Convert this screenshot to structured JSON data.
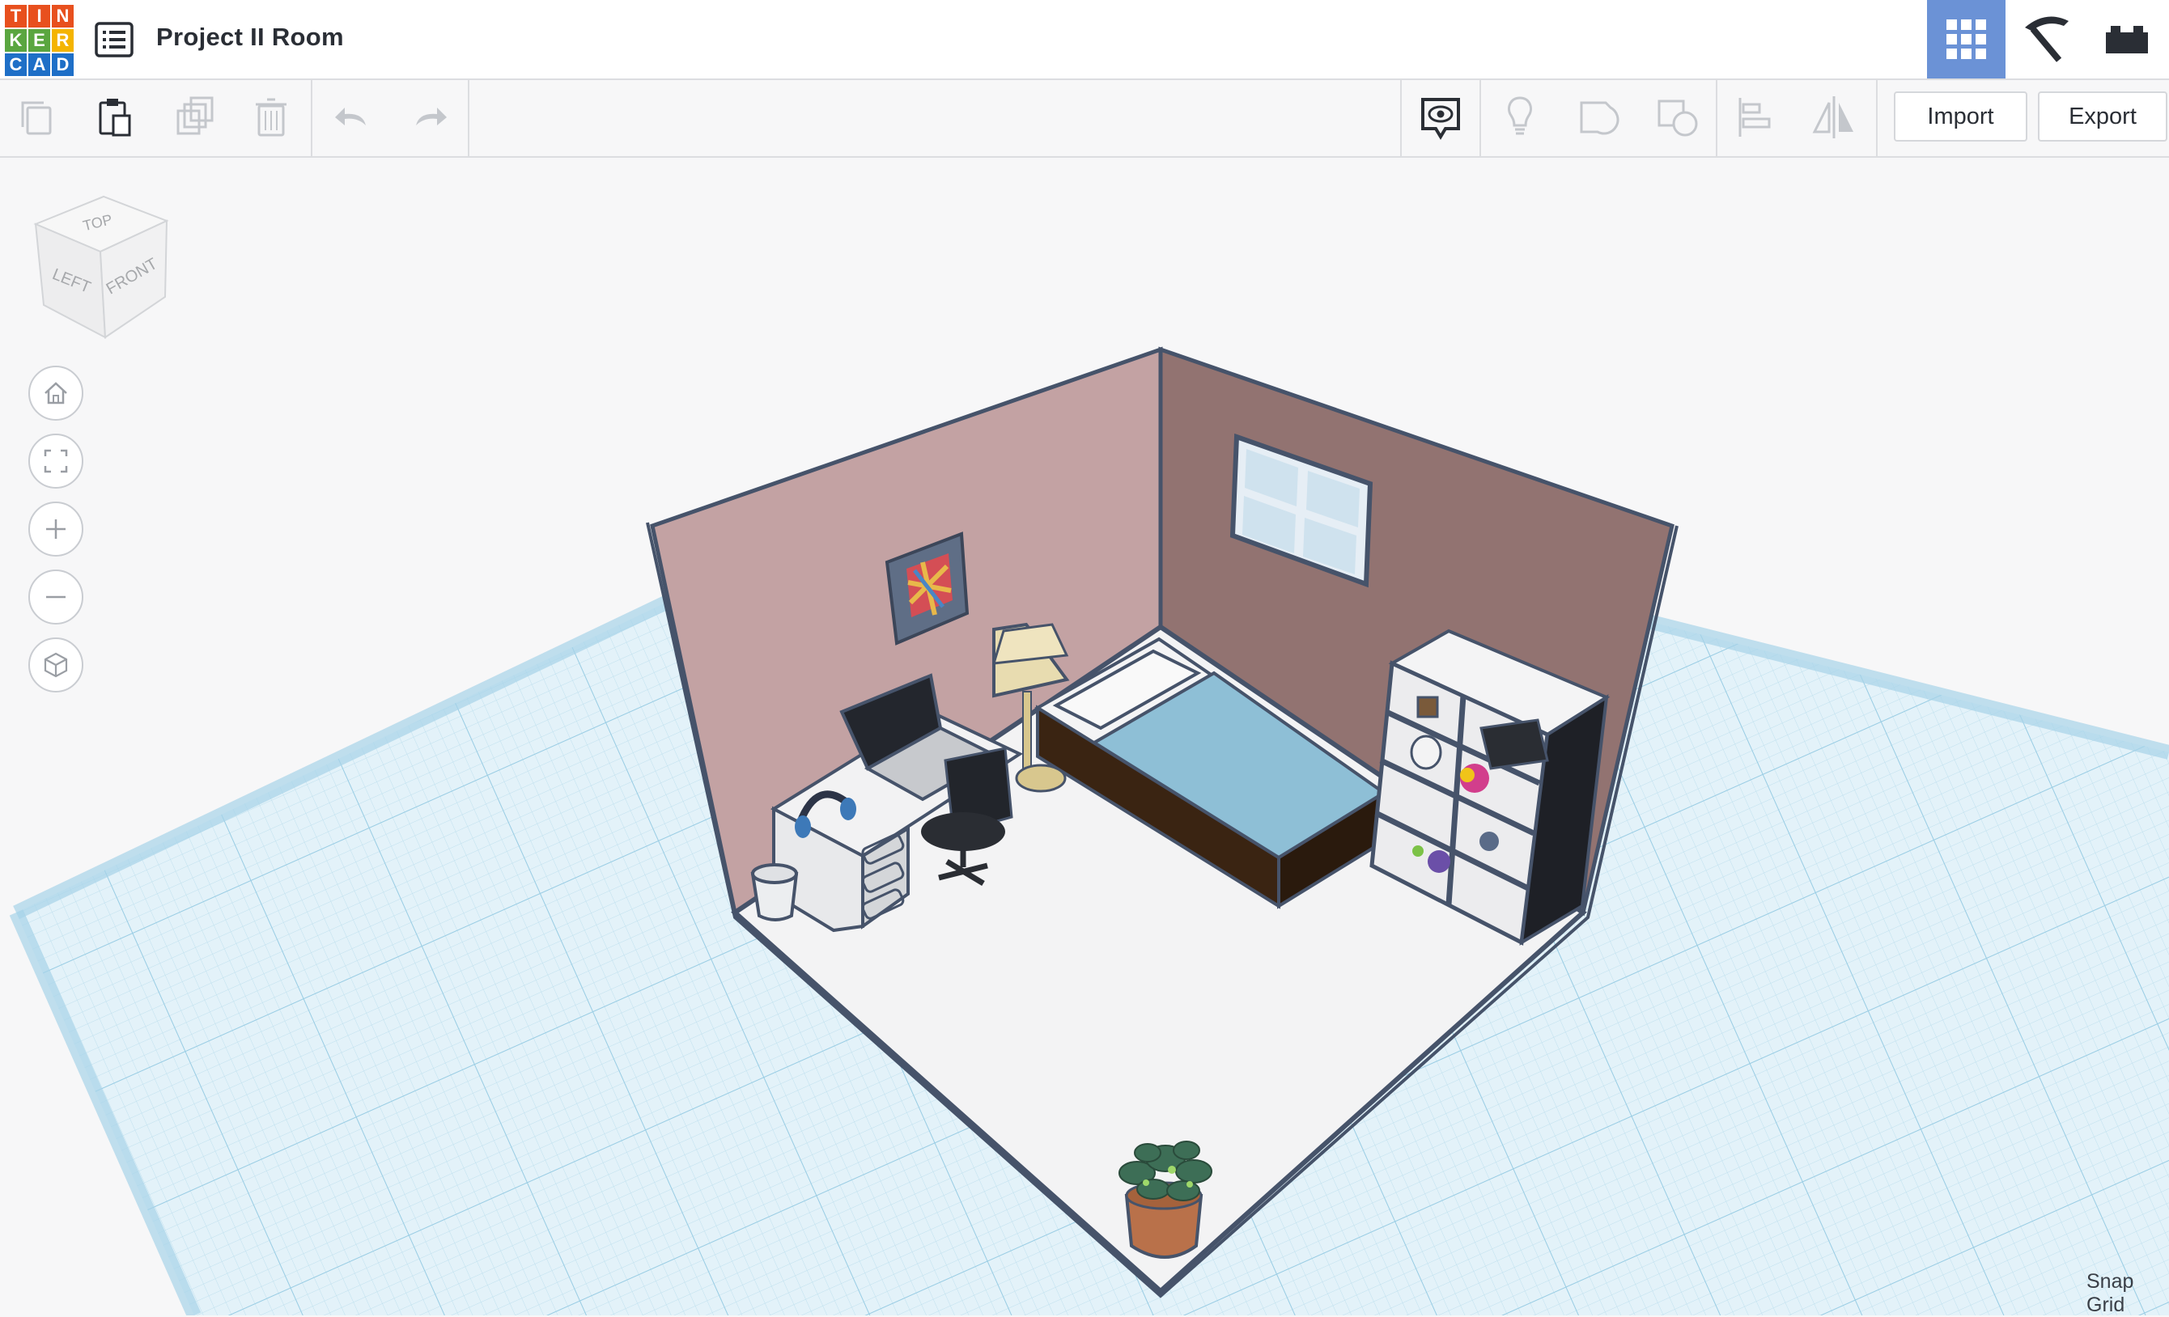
{
  "header": {
    "logo_letters": [
      "T",
      "I",
      "N",
      "K",
      "E",
      "R",
      "C",
      "A",
      "D"
    ],
    "logo_colors": [
      "#e8501e",
      "#e8501e",
      "#e8501e",
      "#5aa640",
      "#5aa640",
      "#f4b400",
      "#1e6fc7",
      "#1e6fc7",
      "#1e6fc7"
    ],
    "menu_icon": "list-icon",
    "project_title": "Project II Room",
    "views": [
      {
        "icon": "3d-design-grid-icon",
        "active": true
      },
      {
        "icon": "pickaxe-icon",
        "active": false
      },
      {
        "icon": "bricks-icon",
        "active": false
      }
    ]
  },
  "toolbar": {
    "left_tools": [
      {
        "icon": "copy-icon"
      },
      {
        "icon": "paste-icon"
      },
      {
        "icon": "duplicate-icon"
      },
      {
        "icon": "delete-icon"
      },
      {
        "icon": "undo-icon"
      },
      {
        "icon": "redo-icon"
      }
    ],
    "right_tools": [
      {
        "icon": "notes-eye-icon"
      },
      {
        "icon": "lightbulb-icon"
      },
      {
        "icon": "group-icon"
      },
      {
        "icon": "ungroup-icon"
      },
      {
        "icon": "align-icon"
      },
      {
        "icon": "mirror-icon"
      }
    ],
    "import_label": "Import",
    "export_label": "Export"
  },
  "viewcube": {
    "top": "TOP",
    "left": "LEFT",
    "front": "FRONT"
  },
  "view_controls": [
    {
      "icon": "home-view-icon"
    },
    {
      "icon": "fit-all-icon"
    },
    {
      "icon": "zoom-in-icon"
    },
    {
      "icon": "zoom-out-icon"
    },
    {
      "icon": "perspective-icon"
    }
  ],
  "footer": {
    "snap_grid_label": "Snap Grid"
  },
  "colors": {
    "accent": "#6b92d6",
    "grid_fill": "#d9eef7",
    "grid_line": "#a8d3e7",
    "left_wall": "#c3a2a3",
    "right_wall": "#927371",
    "floor": "#f3f3f4",
    "mattress": "#8ebfd6",
    "bed_base": "#3a2412"
  }
}
